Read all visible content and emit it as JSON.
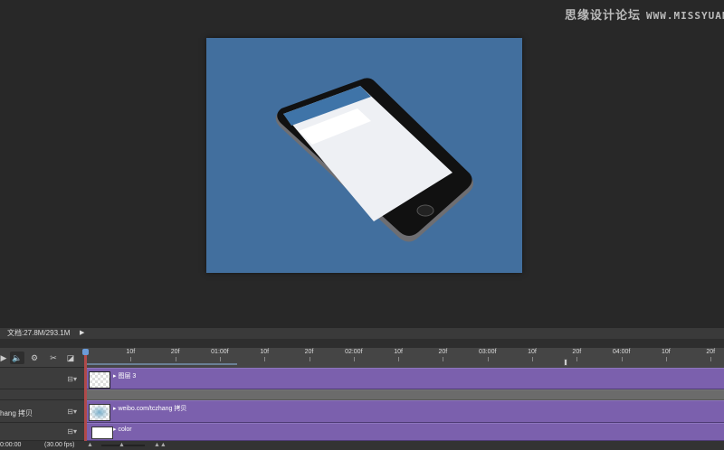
{
  "watermark": {
    "cn": "思缘设计论坛",
    "url": "WWW.MISSYUAN.COM"
  },
  "colors": {
    "canvas": "#426f9e",
    "track": "#7b60ad",
    "playhead": "#b04a4a"
  },
  "status": {
    "doc_size": "文档:27.8M/293.1M",
    "menu_arrow": "▶"
  },
  "controls": [
    {
      "icon": "play-icon",
      "glyph": "▶"
    },
    {
      "icon": "audio-icon",
      "glyph": "🔈"
    },
    {
      "icon": "settings-icon",
      "glyph": "⚙"
    },
    {
      "icon": "split-scissors-icon",
      "glyph": "✂"
    },
    {
      "icon": "transition-icon",
      "glyph": "◪"
    }
  ],
  "ruler": [
    "10f",
    "20f",
    "01:00f",
    "10f",
    "20f",
    "02:00f",
    "10f",
    "20f",
    "03:00f",
    "10f",
    "20f",
    "04:00f",
    "10f",
    "20f"
  ],
  "layers": [
    {
      "left_name": "",
      "clip": "图层 3",
      "type": "video"
    },
    {
      "left_name": "",
      "clip": "",
      "type": "group"
    },
    {
      "left_name": "hang 拷贝",
      "clip": "weibo.com/tczhang 拷贝",
      "type": "video"
    },
    {
      "left_name": "",
      "clip": "color",
      "type": "video"
    }
  ],
  "bottom": {
    "timecode": "0:00:00",
    "fps": "(30.00 fps)"
  }
}
